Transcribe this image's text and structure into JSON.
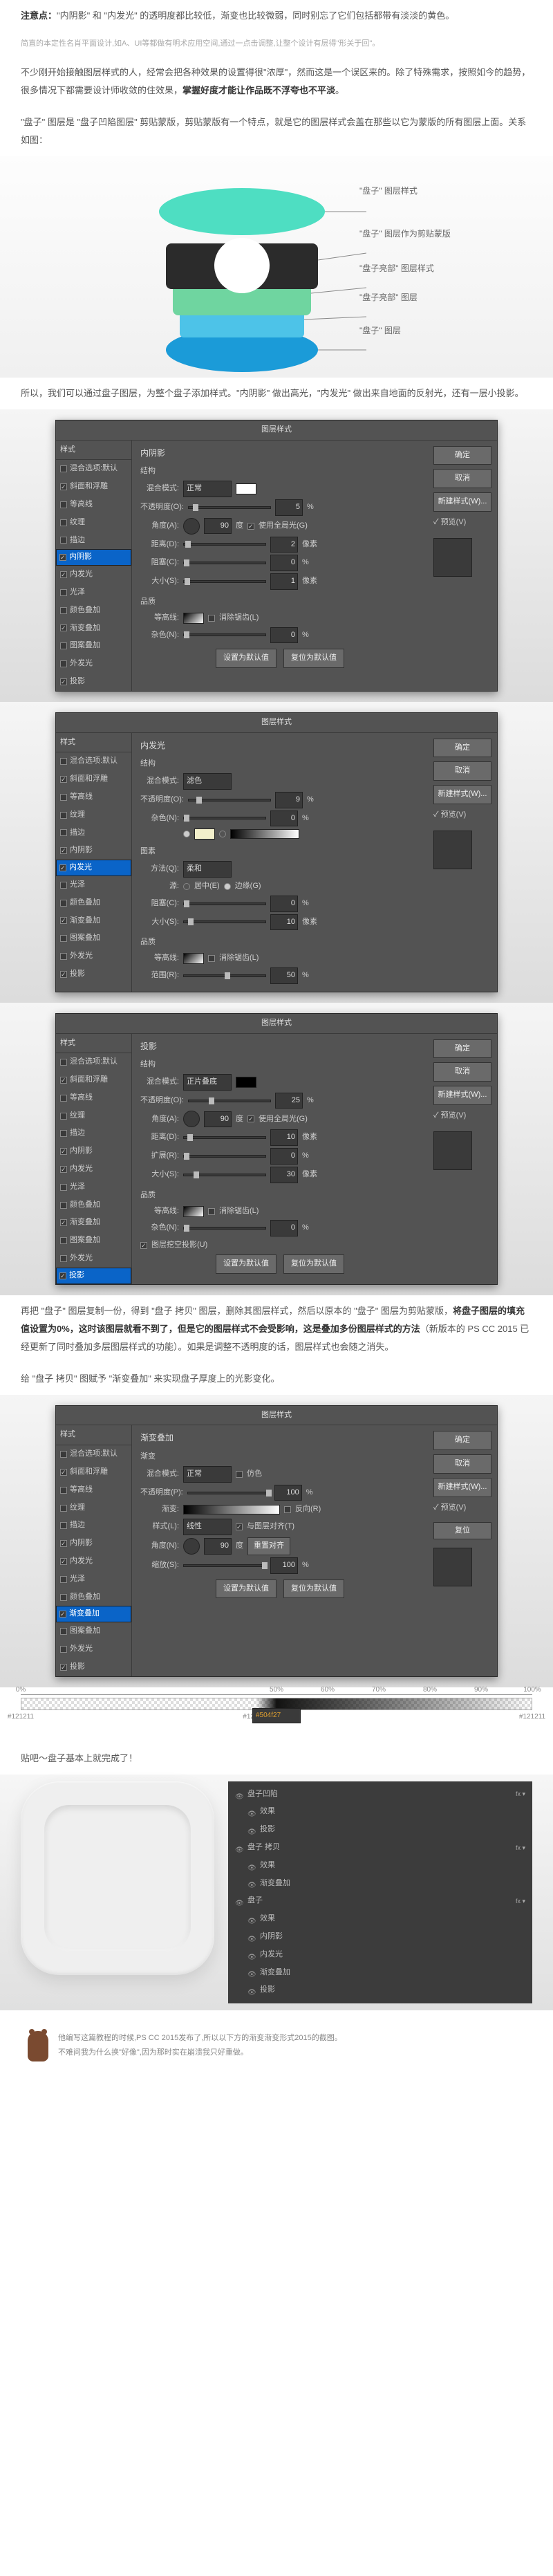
{
  "top_note": {
    "prefix": "注意点：",
    "body": "\"内阴影\" 和 \"内发光\" 的透明度都比较低，渐变也比较微弱，同时别忘了它们包括都带有淡淡的黄色。",
    "tag": "简直的本定性名肖平面设计,如A、UI等都做有明术应用空间,通过一点击调整,让整个设计有层得\"形关于回\"。"
  },
  "para1": {
    "a": "不少刚开始接触图层样式的人，经常会把各种效果的设置得很\"浓厚\"，然而这是一个误区来的。除了特殊需求，按照如今的趋势，很多情况下都需要设计师收敛的住效果，",
    "b": "掌握好度才能让作品既不浮夸也不平淡",
    "c": "。"
  },
  "para2": "\"盘子\" 图层是 \"盘子凹陷图层\" 剪贴蒙版，剪贴蒙版有一个特点，就是它的图层样式会盖在那些以它为蒙版的所有图层上面。关系如图：",
  "diagram_labels": {
    "l1": "\"盘子\" 图层样式",
    "l2": "\"盘子\" 图层作为剪贴蒙版",
    "l3": "\"盘子亮部\" 图层样式",
    "l4": "\"盘子亮部\" 图层",
    "l5": "\"盘子\" 图层"
  },
  "para3": "所以，我们可以通过盘子图层，为整个盘子添加样式。\"内阴影\" 做出高光，\"内发光\" 做出来自地面的反射光，还有一层小投影。",
  "ps": {
    "title": "图层样式",
    "side_hdr": "样式",
    "side_items": [
      {
        "label": "混合选项:默认",
        "cb": false
      },
      {
        "label": "斜面和浮雕",
        "cb": true
      },
      {
        "label": "等高线",
        "cb": false
      },
      {
        "label": "纹理",
        "cb": false
      },
      {
        "label": "描边",
        "cb": false
      },
      {
        "label": "内阴影",
        "cb": true
      },
      {
        "label": "内发光",
        "cb": true
      },
      {
        "label": "光泽",
        "cb": false
      },
      {
        "label": "颜色叠加",
        "cb": false
      },
      {
        "label": "渐变叠加",
        "cb": true
      },
      {
        "label": "图案叠加",
        "cb": false
      },
      {
        "label": "外发光",
        "cb": false
      },
      {
        "label": "投影",
        "cb": true
      }
    ],
    "btns": {
      "ok": "确定",
      "cancel": "取消",
      "new": "新建样式(W)...",
      "preview": "✓ 预览(V)"
    },
    "inner_shadow": {
      "title": "内阴影",
      "struct": "结构",
      "blend_lbl": "混合模式:",
      "blend_val": "正常",
      "opacity_lbl": "不透明度(O):",
      "opacity_val": "5",
      "opacity_unit": "%",
      "angle_lbl": "角度(A):",
      "angle_val": "90",
      "angle_unit": "度",
      "global": "使用全局光(G)",
      "dist_lbl": "距离(D):",
      "dist_val": "2",
      "dist_unit": "像素",
      "choke_lbl": "阻塞(C):",
      "choke_val": "0",
      "choke_unit": "%",
      "size_lbl": "大小(S):",
      "size_val": "1",
      "size_unit": "像素",
      "quality": "品质",
      "contour": "等高线:",
      "anti": "消除锯齿(L)",
      "noise_lbl": "杂色(N):",
      "noise_val": "0",
      "noise_unit": "%",
      "default": "设置为默认值",
      "reset": "复位为默认值"
    },
    "inner_glow": {
      "title": "内发光",
      "struct": "结构",
      "blend_lbl": "混合模式:",
      "blend_val": "滤色",
      "opacity_lbl": "不透明度(O):",
      "opacity_val": "9",
      "opacity_unit": "%",
      "noise_lbl": "杂色(N):",
      "noise_val": "0",
      "noise_unit": "%",
      "elem": "图素",
      "tech_lbl": "方法(Q):",
      "tech_val": "柔和",
      "src_lbl": "源:",
      "src_center": "居中(E)",
      "src_edge": "边缘(G)",
      "choke_lbl": "阻塞(C):",
      "choke_val": "0",
      "choke_unit": "%",
      "size_lbl": "大小(S):",
      "size_val": "10",
      "size_unit": "像素",
      "quality": "品质",
      "contour": "等高线:",
      "anti": "消除锯齿(L)",
      "range_lbl": "范围(R):",
      "range_val": "50",
      "range_unit": "%"
    },
    "drop_shadow": {
      "title": "投影",
      "struct": "结构",
      "blend_lbl": "混合模式:",
      "blend_val": "正片叠底",
      "opacity_lbl": "不透明度(O):",
      "opacity_val": "25",
      "opacity_unit": "%",
      "angle_lbl": "角度(A):",
      "angle_val": "90",
      "angle_unit": "度",
      "global": "使用全局光(G)",
      "dist_lbl": "距离(D):",
      "dist_val": "10",
      "dist_unit": "像素",
      "spread_lbl": "扩展(R):",
      "spread_val": "0",
      "spread_unit": "%",
      "size_lbl": "大小(S):",
      "size_val": "30",
      "size_unit": "像素",
      "quality": "品质",
      "contour": "等高线:",
      "anti": "消除锯齿(L)",
      "noise_lbl": "杂色(N):",
      "noise_val": "0",
      "noise_unit": "%",
      "knock": "图层挖空投影(U)",
      "default": "设置为默认值",
      "reset": "复位为默认值"
    },
    "grad_overlay": {
      "title": "渐变叠加",
      "sub": "渐变",
      "blend_lbl": "混合模式:",
      "blend_val": "正常",
      "dither": "仿色",
      "opacity_lbl": "不透明度(P):",
      "opacity_val": "100",
      "opacity_unit": "%",
      "grad_lbl": "渐变:",
      "reverse": "反向(R)",
      "style_lbl": "样式(L):",
      "style_val": "线性",
      "align": "与图层对齐(T)",
      "angle_lbl": "角度(N):",
      "angle_val": "90",
      "angle_unit": "度",
      "reset_align": "重置对齐",
      "scale_lbl": "缩放(S):",
      "scale_val": "100",
      "scale_unit": "%",
      "default": "设置为默认值",
      "reset": "复位为默认值"
    }
  },
  "para4": {
    "a": "再把 \"盘子\" 图层复制一份，得到 \"盘子 拷贝\" 图层，删除其图层样式，然后以原本的 \"盘子\" 图层为剪贴蒙版，",
    "b": "将盘子图层的填充值设置为0%，这时该图层就看不到了，但是它的图层样式不会受影响，这是叠加多份图层样式的方法",
    "c": "（新版本的 PS CC 2015 已经更新了同时叠加多层图层样式的功能）。如果是调整不透明度的话，图层样式也会随之消失。"
  },
  "para5": "给 \"盘子 拷贝\" 图赋予 \"渐变叠加\" 来实现盘子厚度上的光影变化。",
  "ruler": {
    "ticks": [
      "0%",
      "50%",
      "60%",
      "70%",
      "80%",
      "90%",
      "100%"
    ],
    "stops": [
      {
        "pos": "0",
        "label": "#121211",
        "sel": false
      },
      {
        "pos": "46",
        "label": "#121211",
        "sel": false
      },
      {
        "pos": "50",
        "label": "#504f27",
        "sel": true
      },
      {
        "pos": "100",
        "label": "#121211",
        "sel": false
      }
    ]
  },
  "para6": "贴吧～盘子基本上就完成了！",
  "layers": [
    {
      "label": "盘子凹陷",
      "indent": 0,
      "fx": "fx ▾"
    },
    {
      "label": "效果",
      "indent": 1
    },
    {
      "label": "投影",
      "indent": 1
    },
    {
      "label": "盘子 拷贝",
      "indent": 0,
      "fx": "fx ▾"
    },
    {
      "label": "效果",
      "indent": 1
    },
    {
      "label": "渐变叠加",
      "indent": 1
    },
    {
      "label": "盘子",
      "indent": 0,
      "fx": "fx ▾"
    },
    {
      "label": "效果",
      "indent": 1
    },
    {
      "label": "内阴影",
      "indent": 1
    },
    {
      "label": "内发光",
      "indent": 1
    },
    {
      "label": "渐变叠加",
      "indent": 1
    },
    {
      "label": "投影",
      "indent": 1
    }
  ],
  "footer": {
    "l1": "他编写这篇教程的时候,PS CC 2015发布了,所以以下方的渐变渐变形式2015的截图。",
    "l2": "不难问我为什么换\"好像\",因为那时实在崩溃我只好重做。"
  }
}
